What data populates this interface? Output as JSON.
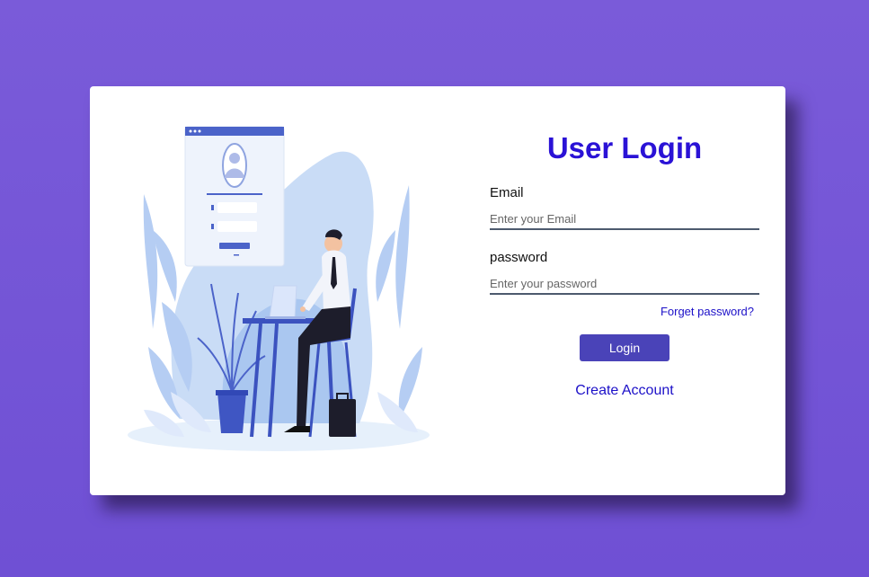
{
  "login": {
    "title": "User Login",
    "email_label": "Email",
    "email_placeholder": "Enter your Email",
    "password_label": "password",
    "password_placeholder": "Enter your password",
    "forgot_link": "Forget password?",
    "login_button": "Login",
    "create_account": "Create Account"
  },
  "colors": {
    "background": "#7459d8",
    "title": "#2a12d6",
    "button": "#4a43b8",
    "link": "#1c10c8"
  },
  "icons": [
    "login-illustration"
  ]
}
